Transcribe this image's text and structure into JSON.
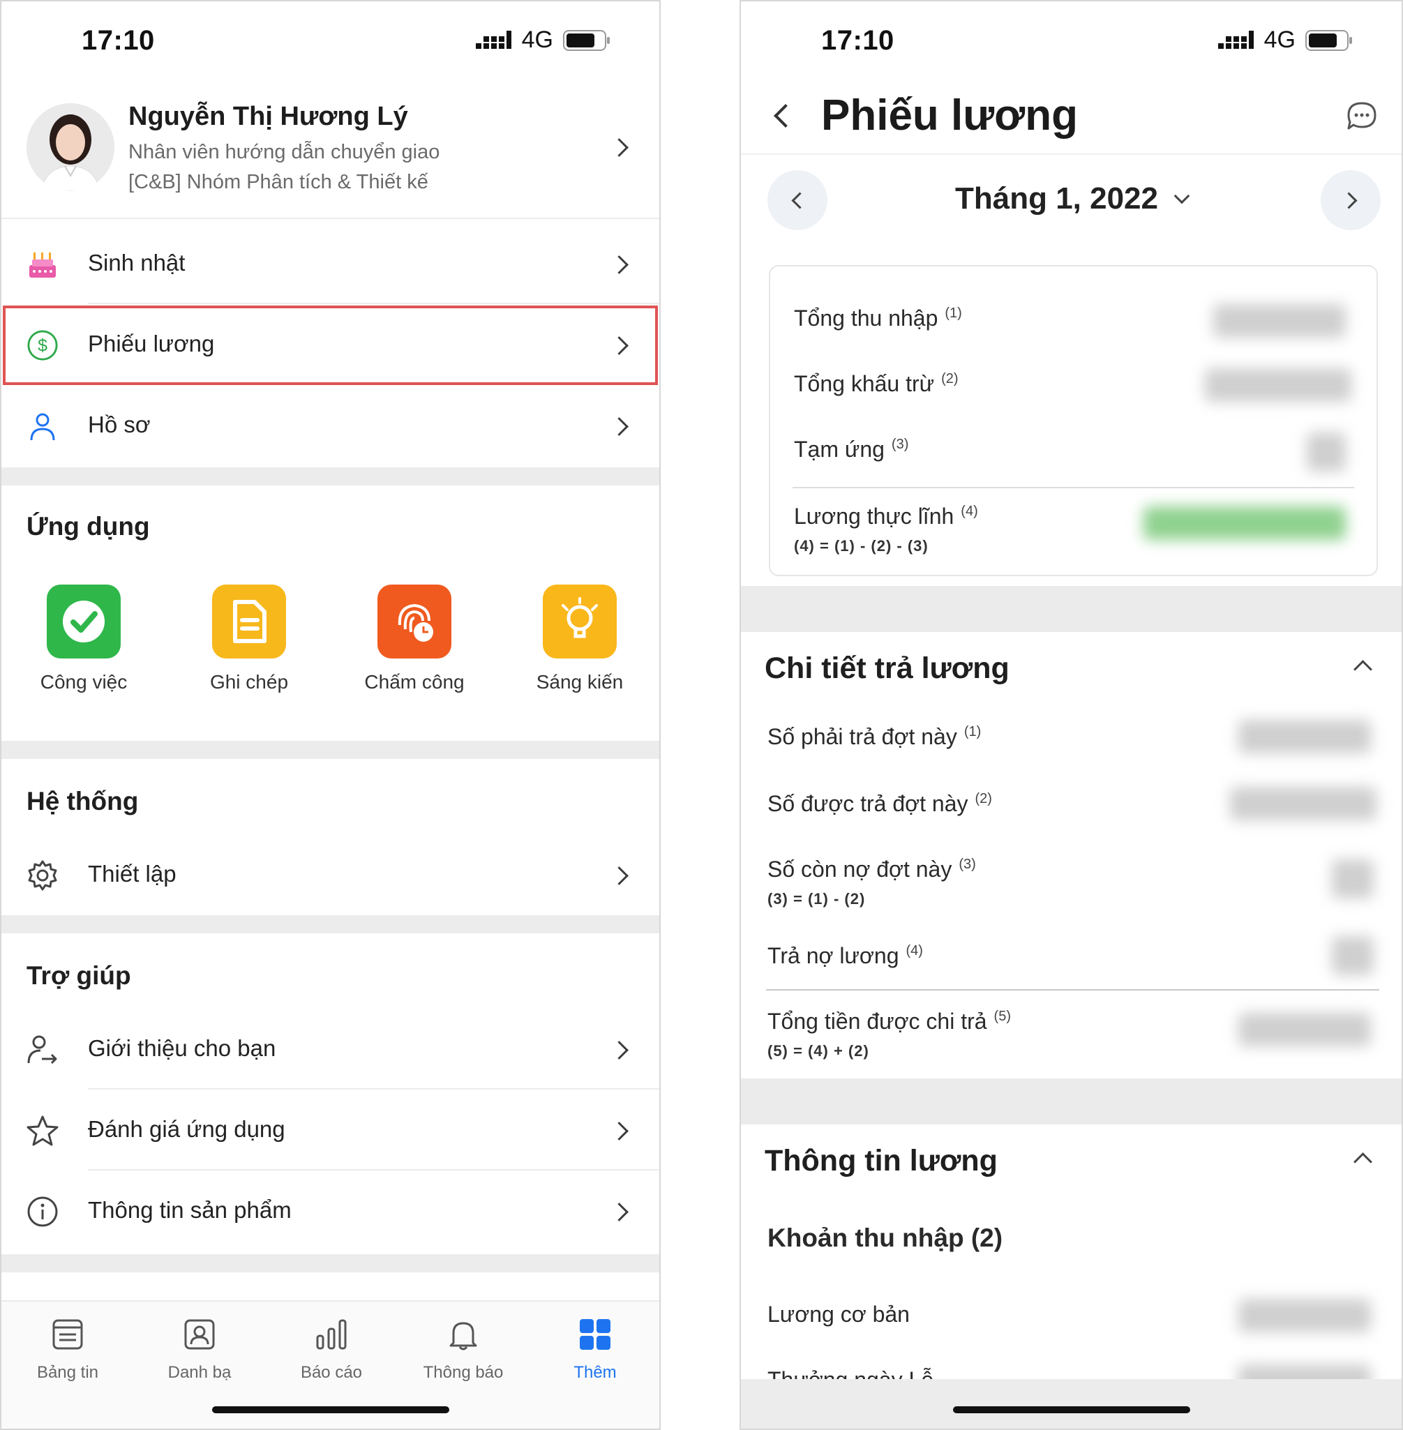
{
  "left": {
    "status": {
      "time": "17:10",
      "network": "4G"
    },
    "profile": {
      "name": "Nguyễn Thị Hương Lý",
      "role": "Nhân viên hướng dẫn chuyển giao",
      "team": "[C&B] Nhóm Phân tích & Thiết kế"
    },
    "menu": [
      {
        "label": "Sinh nhật",
        "icon": "birthday-cake-icon"
      },
      {
        "label": "Phiếu lương",
        "icon": "dollar-circle-icon"
      },
      {
        "label": "Hồ sơ",
        "icon": "person-icon"
      }
    ],
    "apps_title": "Ứng dụng",
    "apps": [
      {
        "label": "Công việc",
        "icon": "checkmark-icon",
        "color": "#2fb74a"
      },
      {
        "label": "Ghi chép",
        "icon": "note-icon",
        "color": "#f7b81c"
      },
      {
        "label": "Chấm công",
        "icon": "fingerprint-clock-icon",
        "color": "#f05a1f"
      },
      {
        "label": "Sáng kiến",
        "icon": "lightbulb-icon",
        "color": "#f9b71a"
      }
    ],
    "system_title": "Hệ thống",
    "system": [
      {
        "label": "Thiết lập",
        "icon": "gear-icon"
      }
    ],
    "help_title": "Trợ giúp",
    "help": [
      {
        "label": "Giới thiệu cho bạn",
        "icon": "share-user-icon"
      },
      {
        "label": "Đánh giá ứng dụng",
        "icon": "star-icon"
      },
      {
        "label": "Thông tin sản phẩm",
        "icon": "info-icon"
      }
    ],
    "tabs": [
      {
        "label": "Bảng tin",
        "icon": "newsfeed-icon"
      },
      {
        "label": "Danh bạ",
        "icon": "contacts-icon"
      },
      {
        "label": "Báo cáo",
        "icon": "bar-chart-icon"
      },
      {
        "label": "Thông báo",
        "icon": "bell-icon"
      },
      {
        "label": "Thêm",
        "icon": "grid-icon",
        "active": true
      }
    ],
    "accent": "#1e74f0",
    "highlight_color": "#e05454"
  },
  "right": {
    "status": {
      "time": "17:10",
      "network": "4G"
    },
    "title": "Phiếu lương",
    "month": "Tháng 1, 2022",
    "summary": [
      {
        "label": "Tổng thu nhập",
        "note": "(1)"
      },
      {
        "label": "Tổng khấu trừ",
        "note": "(2)"
      },
      {
        "label": "Tạm ứng",
        "note": "(3)"
      },
      {
        "label": "Lương thực lĩnh",
        "note": "(4)",
        "formula": "(4) = (1) - (2) - (3)"
      }
    ],
    "payment_title": "Chi tiết trả lương",
    "payment": [
      {
        "label": "Số phải trả đợt này",
        "note": "(1)"
      },
      {
        "label": "Số được trả đợt này",
        "note": "(2)"
      },
      {
        "label": "Số còn nợ đợt này",
        "note": "(3)",
        "formula": "(3) = (1) - (2)"
      },
      {
        "label": "Trả nợ lương",
        "note": "(4)"
      },
      {
        "label": "Tổng tiền được chi trả",
        "note": "(5)",
        "formula": "(5) = (4) + (2)"
      }
    ],
    "info_title": "Thông tin lương",
    "income_title": "Khoản thu nhập (2)",
    "income": [
      {
        "label": "Lương cơ bản"
      },
      {
        "label": "Thưởng ngày Lễ"
      }
    ]
  }
}
